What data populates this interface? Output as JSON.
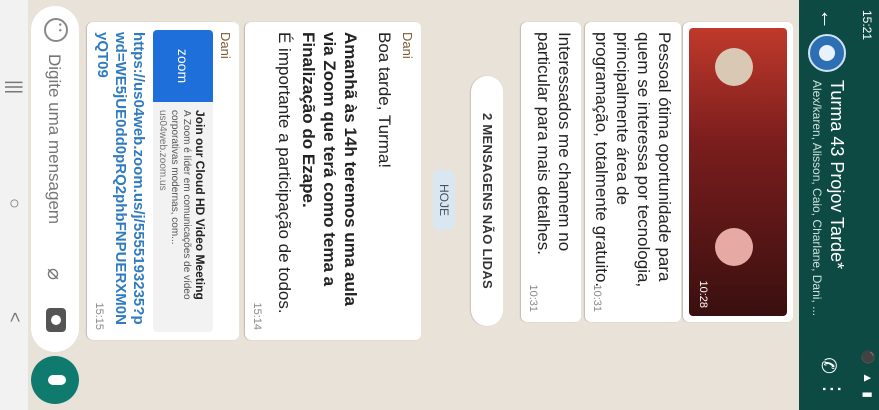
{
  "status_bar": {
    "time": "15:21",
    "icons": "⚫ ▲ ▮"
  },
  "header": {
    "title": "Turma 43 Projov Tarde*",
    "subtitle": "Alex/karen, Alisson, Caio, Charlane, Dani, ...",
    "back_icon": "arrow-left-icon",
    "call_icon": "add-call-icon",
    "menu_icon": "more-vertical-icon",
    "accent": "#0d4a44"
  },
  "messages": {
    "image_time": "10:28",
    "text1": "Pessoal ótima oportunidade para quem se interessa por tecnologia, principalmente área de programação, totalmente gratuito.",
    "text1_time": "10:31",
    "text2": "Interessados me chamem no particular para mais detalhes.",
    "text2_time": "10:31",
    "unread_label": "2 MENSAGENS NÃO LIDAS",
    "day_label": "HOJE",
    "dani1": {
      "sender": "Dani",
      "greeting": "Boa tarde, Turma!",
      "bold": "Amanhã às 14h teremos uma aula via Zoom que terá como tema a Finalização do Ezape.",
      "important": "É importante a participação de todos.",
      "time": "15:14"
    },
    "dani2": {
      "sender": "Dani",
      "card_logo": "zoom",
      "card_title": "Join our Cloud HD Video Meeting",
      "card_desc": "A Zoom é líder em comunicações de vídeo corporativas modernas, com...",
      "card_domain": "us04web.zoom.us",
      "link": "https://us04web.zoom.us/j/5555193235?pwd=WE5jUE0dd0pRQ2phbFNPUERXM0NyQT09",
      "time": "15:15"
    }
  },
  "composer": {
    "placeholder": "Digite uma mensagem"
  },
  "nav": {
    "recent": "|||",
    "home": "○",
    "back": "<"
  }
}
